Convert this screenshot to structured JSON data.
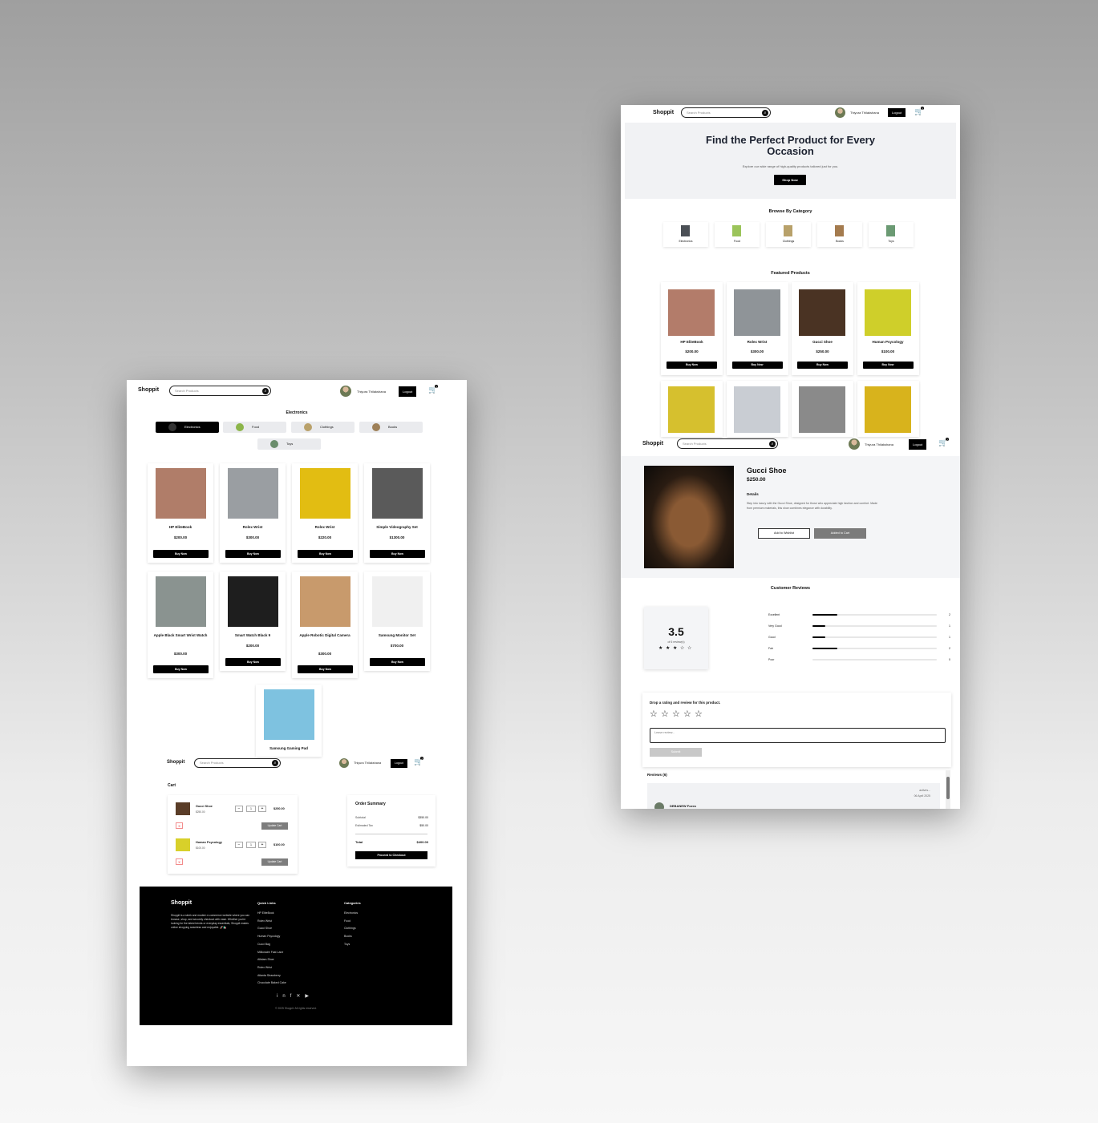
{
  "brand": "Shoppit",
  "search_placeholder": "Search Products",
  "user_name": "Thiyura Thilakshana",
  "logout_label": "Logout",
  "cart_badges": {
    "home": "3",
    "detail": "2",
    "category": "3",
    "cart": "2"
  },
  "home": {
    "hero_title": "Find the Perfect Product for Every Occasion",
    "hero_text": "Explore our wide range of high-quality products tailored just for you.",
    "hero_button": "Shop Now",
    "browse_title": "Browse By Category",
    "categories": [
      {
        "label": "Electronics",
        "color": "#4a4f55"
      },
      {
        "label": "Food",
        "color": "#9bc45a"
      },
      {
        "label": "Clothings",
        "color": "#b8a16a"
      },
      {
        "label": "Books",
        "color": "#a47b4e"
      },
      {
        "label": "Toys",
        "color": "#6b9a73"
      }
    ],
    "featured_title": "Featured Products",
    "featured": [
      {
        "name": "HP EliteBook",
        "price": "$200.00",
        "button": "Buy Now",
        "color": "#b37c6a"
      },
      {
        "name": "Rolex Wrist",
        "price": "$300.00",
        "button": "Buy Now",
        "color": "#8f9498"
      },
      {
        "name": "Gucci Shoe",
        "price": "$250.00",
        "button": "Buy Now",
        "color": "#4a3323"
      },
      {
        "name": "Human Psycology",
        "price": "$100.00",
        "button": "Buy Now",
        "color": "#cfcf2a"
      }
    ],
    "featured_row2_colors": [
      "#d6c02e",
      "#c9cdd3",
      "#8a8a8a",
      "#d8b31c"
    ]
  },
  "detail": {
    "title": "Gucci Shoe",
    "price": "$250.00",
    "details_heading": "Details",
    "description": "Step into luxury with the Gucci Shoe, designed for those who appreciate high fashion and comfort. Made from premium materials, this shoe combines elegance with durability.",
    "wishlist_button": "Add to Wishlist",
    "added_button": "Added to Cart",
    "reviews_heading": "Customer Reviews",
    "rating": "3.5",
    "rating_sub": "of 6 review(s)",
    "rating_stars": 3.5,
    "breakdown": [
      {
        "label": "Excellent",
        "count": "2",
        "fraction": 0.2
      },
      {
        "label": "Very Good",
        "count": "1",
        "fraction": 0.1
      },
      {
        "label": "Good",
        "count": "1",
        "fraction": 0.1
      },
      {
        "label": "Fair",
        "count": "2",
        "fraction": 0.2
      },
      {
        "label": "Poor",
        "count": "0",
        "fraction": 0.0
      }
    ],
    "drop_title": "Drop a rating and review for this product.",
    "review_placeholder": "Leave review...",
    "submit_label": "Submit",
    "reviews_list_title": "Reviews (6)",
    "first_review": {
      "author": "DEBANEW Foera",
      "action": "actives...",
      "date": "06 April 2025"
    }
  },
  "category_page": {
    "title": "Electronics",
    "tabs": [
      {
        "label": "Electronics",
        "active": true
      },
      {
        "label": "Food",
        "active": false
      },
      {
        "label": "Clothings",
        "active": false
      },
      {
        "label": "Books",
        "active": false
      },
      {
        "label": "Toys",
        "active": false
      }
    ],
    "products": [
      {
        "name": "HP EliteBook",
        "price": "$200.00",
        "button": "Buy Now",
        "color": "#b07d69"
      },
      {
        "name": "Rolex Wrist",
        "price": "$300.00",
        "button": "Buy Now",
        "color": "#9a9ea2"
      },
      {
        "name": "Rolex Wrist",
        "price": "$220.00",
        "button": "Buy Now",
        "color": "#e2bd12"
      },
      {
        "name": "Simple Videography Set",
        "price": "$1300.00",
        "button": "Buy Now",
        "color": "#5a5a5a"
      },
      {
        "name": "Apple Black Smart Wrist Watch",
        "price": "$300.00",
        "button": "Buy Now",
        "color": "#8a9390"
      },
      {
        "name": "Smart Watch Black 9",
        "price": "$200.00",
        "button": "Buy Now",
        "color": "#1e1e1e"
      },
      {
        "name": "Apple Robotic Digital Camera",
        "price": "$300.00",
        "button": "Buy Now",
        "color": "#c89a6c"
      },
      {
        "name": "Samsung Monitor Set",
        "price": "$700.00",
        "button": "Buy Now",
        "color": "#f0f0f0"
      },
      {
        "name": "Samsung Gaming Pad",
        "price": "",
        "button": "",
        "color": "#7ec2e0"
      }
    ]
  },
  "cart": {
    "title": "Cart",
    "items": [
      {
        "name": "Gucci Shoe",
        "unit": "$250.00",
        "qty": "1",
        "total": "$250.00",
        "update": "Update Cart",
        "color": "#5a3d28"
      },
      {
        "name": "Human Psycology",
        "unit": "$100.00",
        "qty": "1",
        "total": "$100.00",
        "update": "Update Cart",
        "color": "#d8d02a"
      }
    ],
    "summary_title": "Order Summary",
    "subtotal_label": "Subtotal",
    "subtotal": "$350.00",
    "tax_label": "Estimated Tax",
    "tax": "$50.00",
    "total_label": "Total",
    "total": "$400.00",
    "checkout_label": "Proceed to Checkout"
  },
  "footer": {
    "brand": "Shoppit",
    "about": "Shoppit is a sleek and modern e-commerce website where you can browse, shop, and securely checkout with ease. Whether you're looking for the latest trends or everyday essentials, Shoppit makes online shopping seamless and enjoyable. 🚀🛍️",
    "quick_title": "Quick Links",
    "quick_links": [
      "HP EliteBook",
      "Rolex Wrist",
      "Gucci Shoe",
      "Human Psycology",
      "Cucci Bag",
      "Millionaire Fast Lane",
      "Allstars Shoe",
      "Rolex Wrist",
      "Atlanta Strawberry",
      "Chocolate Baked Cake"
    ],
    "cat_title": "Categories",
    "cat_links": [
      "Electronics",
      "Food",
      "Clothings",
      "Books",
      "Toys"
    ],
    "social_icons": [
      "linkedin-icon",
      "facebook-icon",
      "x-icon",
      "youtube-icon"
    ],
    "copyright": "© 2025 Shoppit. All rights reserved."
  }
}
